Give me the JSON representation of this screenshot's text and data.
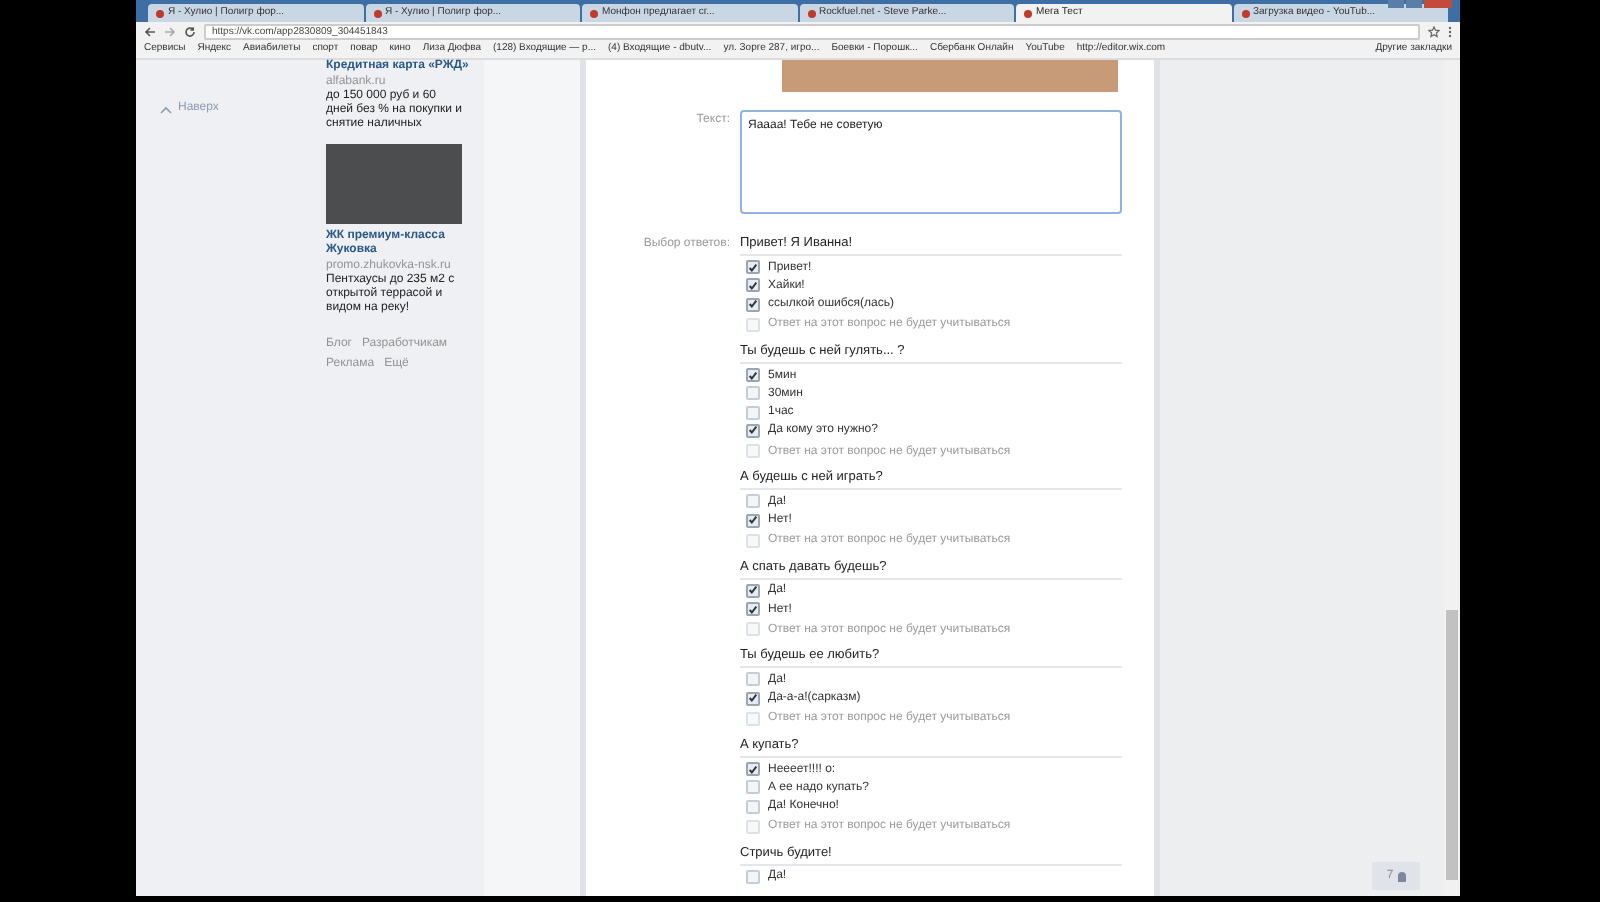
{
  "browser": {
    "tabs": [
      {
        "title": "Я - Хулио | Полигр фор...",
        "selected": false
      },
      {
        "title": "Я - Хулио | Полигр фор...",
        "selected": false
      },
      {
        "title": "Монфон предлагает сг...",
        "selected": false
      },
      {
        "title": "Rockfuel.net - Steve Parke...",
        "selected": false
      },
      {
        "title": "Мега Тест",
        "selected": true
      },
      {
        "title": "Загрузка видео - YouTub...",
        "selected": false
      }
    ],
    "address": "https://vk.com/app2830809_304451843",
    "bookmarks": [
      "Сервисы",
      "Яндекс",
      "Авиабилеты",
      "спорт",
      "повар",
      "кино",
      "Лиза Дюфва",
      "(128) Входящие — р...",
      "(4) Входящие - dbutv...",
      "ул. Зорге 287, игро...",
      "Боевки - Порошк...",
      "Сбербанк Онлайн",
      "YouTube",
      "http://editor.wix.com"
    ],
    "other_bookmarks": "Другие закладки"
  },
  "sidebar": {
    "back_to_top": "Наверх",
    "ads": [
      {
        "title": "Кредитная карта «РЖД»",
        "domain": "alfabank.ru",
        "text": "до 150 000 руб и 60 дней без % на покупки и снятие наличных",
        "kind": "text"
      },
      {
        "title": "ЖК премиум-класса Жуковка",
        "domain": "promo.zhukovka-nsk.ru",
        "text": "Пентхаусы до 235 м2 с открытой террасой и видом на реку!",
        "kind": "photo"
      }
    ],
    "footer_links": [
      "Блог",
      "Разработчикам",
      "Реклама",
      "Ещё"
    ]
  },
  "form": {
    "text_label": "Текст:",
    "text_value": "Яаааа!  Тебе не советую",
    "choices_label": "Выбор ответов:",
    "questions": [
      {
        "title": "Привет! Я Иванна!",
        "options": [
          {
            "label": "Привет!",
            "checked": true
          },
          {
            "label": "Хайки!",
            "checked": true
          },
          {
            "label": "ссылкой ошибся(лась)",
            "checked": true
          }
        ],
        "skip_note": "Ответ на этот вопрос не будет учитываться",
        "skip_checked": false
      },
      {
        "title": "Ты будешь с ней гулять... ?",
        "options": [
          {
            "label": "5мин",
            "checked": true
          },
          {
            "label": "30мин",
            "checked": false
          },
          {
            "label": "1час",
            "checked": false
          },
          {
            "label": "Да кому это нужно?",
            "checked": true
          }
        ],
        "skip_note": "Ответ на этот вопрос не будет учитываться",
        "skip_checked": false
      },
      {
        "title": "А будешь с ней играть?",
        "options": [
          {
            "label": "Да!",
            "checked": false
          },
          {
            "label": "Нет!",
            "checked": true
          }
        ],
        "skip_note": "Ответ на этот вопрос не будет учитываться",
        "skip_checked": false
      },
      {
        "title": "А спать давать будешь?",
        "options": [
          {
            "label": "Да!",
            "checked": true
          },
          {
            "label": "Нет!",
            "checked": true
          }
        ],
        "skip_note": "Ответ на этот вопрос не будет учитываться",
        "skip_checked": false
      },
      {
        "title": "Ты будешь ее любить?",
        "options": [
          {
            "label": "Да!",
            "checked": false
          },
          {
            "label": "Да-а-а!(сарказм)",
            "checked": true
          }
        ],
        "skip_note": "Ответ на этот вопрос не будет учитываться",
        "skip_checked": false
      },
      {
        "title": "А купать?",
        "options": [
          {
            "label": "Неееет!!!! о:",
            "checked": true
          },
          {
            "label": "А ее надо купать?",
            "checked": false
          },
          {
            "label": "Да! Конечно!",
            "checked": false
          }
        ],
        "skip_note": "Ответ на этот вопрос не будет учитываться",
        "skip_checked": false
      },
      {
        "title": "Стричь будите!",
        "options": [
          {
            "label": "Да!",
            "checked": false
          }
        ]
      }
    ]
  },
  "chat_badge": "7"
}
